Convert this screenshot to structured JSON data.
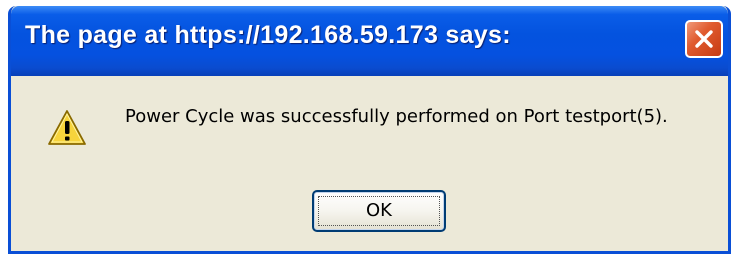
{
  "dialog": {
    "title": "The page at https://192.168.59.173 says:",
    "message": "Power Cycle was successfully performed on Port testport(5).",
    "ok_label": "OK",
    "icon": "warning-icon",
    "close_icon": "close-icon"
  },
  "colors": {
    "titlebar": "#0453df",
    "window_bg": "#ece9d8",
    "close_button": "#e05b2f"
  }
}
